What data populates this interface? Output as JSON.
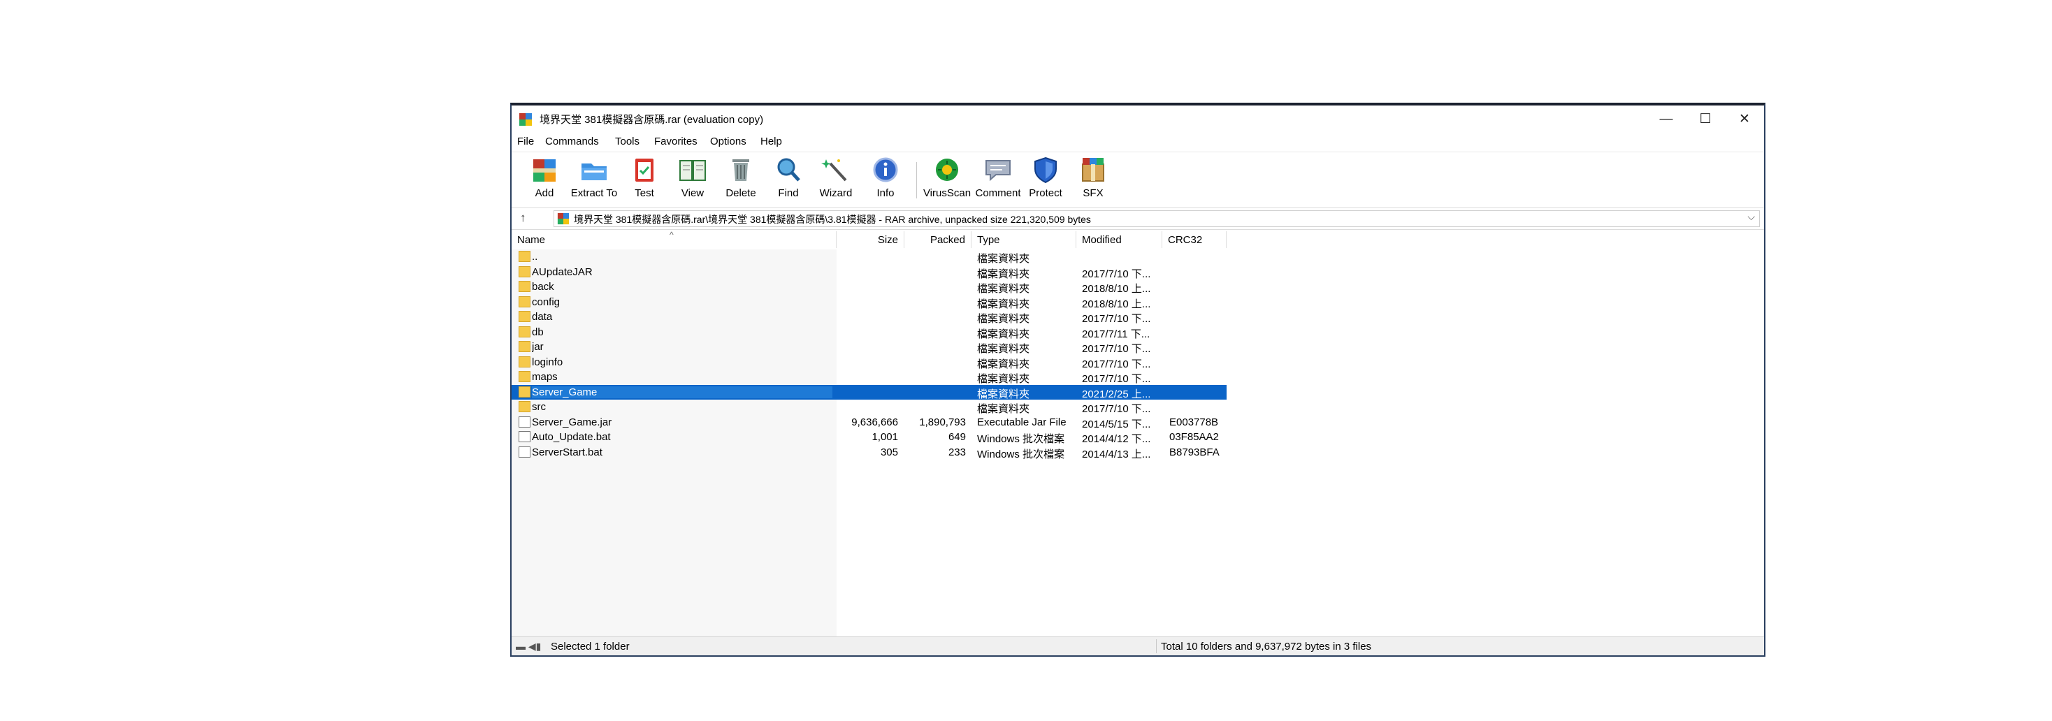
{
  "window": {
    "title": "境界天堂 381模擬器含原碼.rar (evaluation copy)",
    "controls": {
      "minimize": "—",
      "maximize": "☐",
      "close": "✕"
    }
  },
  "menu": [
    "File",
    "Commands",
    "Tools",
    "Favorites",
    "Options",
    "Help"
  ],
  "toolbar": [
    {
      "label": "Add",
      "icon": "add-archive-icon"
    },
    {
      "label": "Extract To",
      "icon": "extract-folder-icon"
    },
    {
      "label": "Test",
      "icon": "test-clipboard-icon"
    },
    {
      "label": "View",
      "icon": "view-book-icon"
    },
    {
      "label": "Delete",
      "icon": "trash-icon"
    },
    {
      "label": "Find",
      "icon": "magnifier-icon"
    },
    {
      "label": "Wizard",
      "icon": "magic-wand-icon"
    },
    {
      "label": "Info",
      "icon": "info-icon"
    },
    {
      "label": "VirusScan",
      "icon": "virus-scan-icon"
    },
    {
      "label": "Comment",
      "icon": "comment-icon"
    },
    {
      "label": "Protect",
      "icon": "shield-icon"
    },
    {
      "label": "SFX",
      "icon": "sfx-box-icon"
    }
  ],
  "address": {
    "up": "↑",
    "path": "境界天堂 381模擬器含原碼.rar\\境界天堂 381模擬器含原碼\\3.81模擬器 - RAR archive, unpacked size 221,320,509 bytes",
    "dropdown": "⌵"
  },
  "columns": {
    "name": "Name",
    "size": "Size",
    "packed": "Packed",
    "type": "Type",
    "modified": "Modified",
    "crc": "CRC32",
    "sort_indicator": "^"
  },
  "rows": [
    {
      "name": "..",
      "size": "",
      "packed": "",
      "type": "檔案資料夾",
      "modified": "",
      "crc": "",
      "kind": "folder"
    },
    {
      "name": "AUpdateJAR",
      "size": "",
      "packed": "",
      "type": "檔案資料夾",
      "modified": "2017/7/10 下...",
      "crc": "",
      "kind": "folder"
    },
    {
      "name": "back",
      "size": "",
      "packed": "",
      "type": "檔案資料夾",
      "modified": "2018/8/10 上...",
      "crc": "",
      "kind": "folder"
    },
    {
      "name": "config",
      "size": "",
      "packed": "",
      "type": "檔案資料夾",
      "modified": "2018/8/10 上...",
      "crc": "",
      "kind": "folder"
    },
    {
      "name": "data",
      "size": "",
      "packed": "",
      "type": "檔案資料夾",
      "modified": "2017/7/10 下...",
      "crc": "",
      "kind": "folder"
    },
    {
      "name": "db",
      "size": "",
      "packed": "",
      "type": "檔案資料夾",
      "modified": "2017/7/11 下...",
      "crc": "",
      "kind": "folder"
    },
    {
      "name": "jar",
      "size": "",
      "packed": "",
      "type": "檔案資料夾",
      "modified": "2017/7/10 下...",
      "crc": "",
      "kind": "folder"
    },
    {
      "name": "loginfo",
      "size": "",
      "packed": "",
      "type": "檔案資料夾",
      "modified": "2017/7/10 下...",
      "crc": "",
      "kind": "folder"
    },
    {
      "name": "maps",
      "size": "",
      "packed": "",
      "type": "檔案資料夾",
      "modified": "2017/7/10 下...",
      "crc": "",
      "kind": "folder"
    },
    {
      "name": "Server_Game",
      "size": "",
      "packed": "",
      "type": "檔案資料夾",
      "modified": "2021/2/25 上...",
      "crc": "",
      "kind": "folder",
      "selected": true
    },
    {
      "name": "src",
      "size": "",
      "packed": "",
      "type": "檔案資料夾",
      "modified": "2017/7/10 下...",
      "crc": "",
      "kind": "folder"
    },
    {
      "name": "Server_Game.jar",
      "size": "9,636,666",
      "packed": "1,890,793",
      "type": "Executable Jar File",
      "modified": "2014/5/15 下...",
      "crc": "E003778B",
      "kind": "file"
    },
    {
      "name": "Auto_Update.bat",
      "size": "1,001",
      "packed": "649",
      "type": "Windows 批次檔案",
      "modified": "2014/4/12 下...",
      "crc": "03F85AA2",
      "kind": "file"
    },
    {
      "name": "ServerStart.bat",
      "size": "305",
      "packed": "233",
      "type": "Windows 批次檔案",
      "modified": "2014/4/13 上...",
      "crc": "B8793BFA",
      "kind": "file"
    }
  ],
  "status": {
    "icons": "▬ ◀▮",
    "left": "Selected 1 folder",
    "right": "Total 10 folders and 9,637,972 bytes in 3 files"
  },
  "colors": {
    "selection": "#0a64c8",
    "folder": "#f6c94a",
    "title_border": "#1b2230"
  }
}
